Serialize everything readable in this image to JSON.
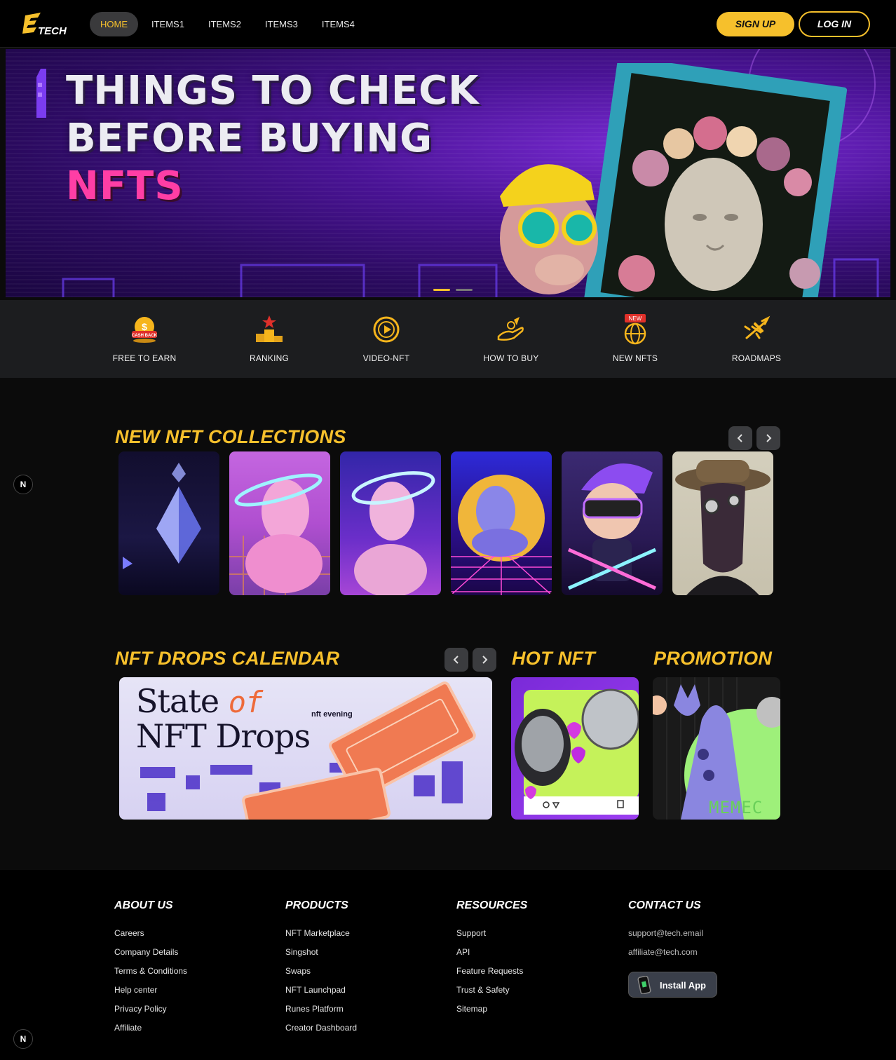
{
  "header": {
    "logo_text": "TECH",
    "nav": [
      {
        "label": "HOME",
        "active": true
      },
      {
        "label": "ITEMS1",
        "active": false
      },
      {
        "label": "ITEMS2",
        "active": false
      },
      {
        "label": "ITEMS3",
        "active": false
      },
      {
        "label": "ITEMS4",
        "active": false
      }
    ],
    "signup_label": "SIGN UP",
    "login_label": "LOG IN"
  },
  "hero": {
    "line1": "THINGS TO CHECK",
    "line2": "BEFORE BUYING",
    "line3": "NFTS",
    "slides": 2,
    "active_slide": 1
  },
  "quick_menu": [
    {
      "label": "FREE TO EARN",
      "icon": "cashback-coin-icon",
      "badge": "CASH BACK"
    },
    {
      "label": "RANKING",
      "icon": "podium-icon"
    },
    {
      "label": "VIDEO-NFT",
      "icon": "play-circle-icon"
    },
    {
      "label": "HOW TO BUY",
      "icon": "hand-coin-icon"
    },
    {
      "label": "NEW NFTS",
      "icon": "globe-icon",
      "badge": "NEW"
    },
    {
      "label": "ROADMAPS",
      "icon": "airplane-icon"
    }
  ],
  "collections": {
    "title": "NEW NFT COLLECTIONS",
    "items": [
      "ethereum-crystal",
      "statue-pink-halo",
      "statue-purple-halo",
      "statue-retro-grid",
      "vr-avatar",
      "hat-character"
    ]
  },
  "drops": {
    "title": "NFT DROPS CALENDAR",
    "banner_line1_a": "State ",
    "banner_line1_b": "of",
    "banner_line2": "NFT Drops",
    "brand": "nft evening"
  },
  "hot": {
    "title": "HOT NFT"
  },
  "promotion": {
    "title": "PROMOTION",
    "card_text": "MEMEC"
  },
  "footer": {
    "about": {
      "title": "ABOUT US",
      "links": [
        "Careers",
        "Company Details",
        "Terms & Conditions",
        "Help center",
        "Privacy Policy",
        "Affiliate"
      ]
    },
    "products": {
      "title": "PRODUCTS",
      "links": [
        "NFT Marketplace",
        "Singshot",
        "Swaps",
        "NFT Launchpad",
        "Runes Platform",
        "Creator Dashboard"
      ]
    },
    "resources": {
      "title": "RESOURCES",
      "links": [
        "Support",
        "API",
        "Feature Requests",
        "Trust & Safety",
        "Sitemap"
      ]
    },
    "contact": {
      "title": "CONTACT US",
      "emails": [
        "support@tech.email",
        "affiliate@tech.com"
      ],
      "install_label": "Install App"
    }
  },
  "side_badge": "N",
  "colors": {
    "accent": "#f6c02c",
    "pink": "#ff3ea5",
    "panel": "#1c1d1f"
  }
}
